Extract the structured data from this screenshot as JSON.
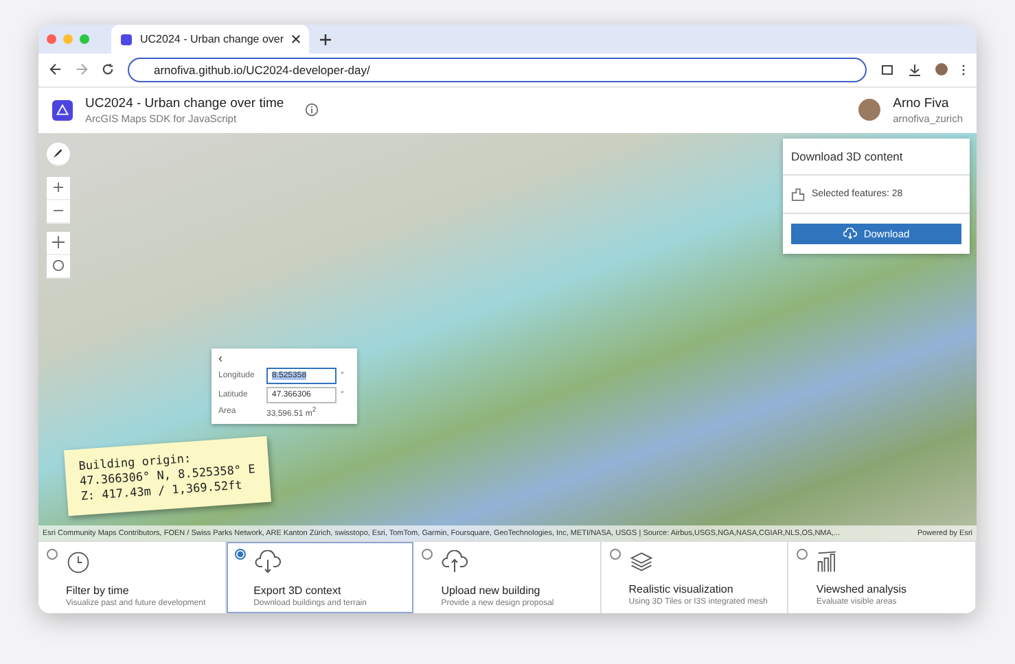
{
  "browser": {
    "tab_title": "UC2024 - Urban change over",
    "url": "arnofiva.github.io/UC2024-developer-day/"
  },
  "app_header": {
    "title": "UC2024 - Urban change over time",
    "subtitle": "ArcGIS Maps SDK for JavaScript",
    "user_name": "Arno Fiva",
    "username": "arnofiva_zurich"
  },
  "download_panel": {
    "title": "Download 3D content",
    "selected_features": "Selected features: 28",
    "button": "Download"
  },
  "coordinate_popup": {
    "back": "‹",
    "fields": [
      {
        "label": "Longitude",
        "value": "8.525358",
        "unit": "°",
        "selected": true
      },
      {
        "label": "Latitude",
        "value": "47.366306",
        "unit": "°",
        "selected": false
      }
    ],
    "area_label": "Area",
    "area_value": "33,596.51 m$^{2}$"
  },
  "sticky_note": {
    "lines": [
      "Building origin:",
      "47.366306° N, 8.525358° E",
      "Z: 417.43m / 1,369.52ft"
    ]
  },
  "attribution": {
    "text": "Esri Community Maps Contributors, FOEN / Swiss Parks Network, ARE Kanton Zürich, swisstopo, Esri, TomTom, Garmin, Foursquare, GeoTechnologies, Inc, METI/NASA, USGS | Source: Airbus,USGS,NGA,NASA,CGIAR,NLS,OS,NMA,...",
    "powered": "Powered by Esri"
  },
  "workflows": [
    {
      "kind": "clock",
      "title": "Filter by time",
      "description": "Visualize past and future development",
      "selected": false
    },
    {
      "kind": "download",
      "title": "Export 3D context",
      "description": "Download buildings and terrain",
      "selected": true
    },
    {
      "kind": "upload",
      "title": "Upload new building",
      "description": "Provide a new design proposal",
      "selected": false
    },
    {
      "kind": "layers",
      "title": "Realistic visualization",
      "description": "Using 3D Tiles or I3S integrated mesh",
      "selected": false
    },
    {
      "kind": "viewshed",
      "title": "Viewshed analysis",
      "description": "Evaluate visible areas",
      "selected": false
    }
  ]
}
